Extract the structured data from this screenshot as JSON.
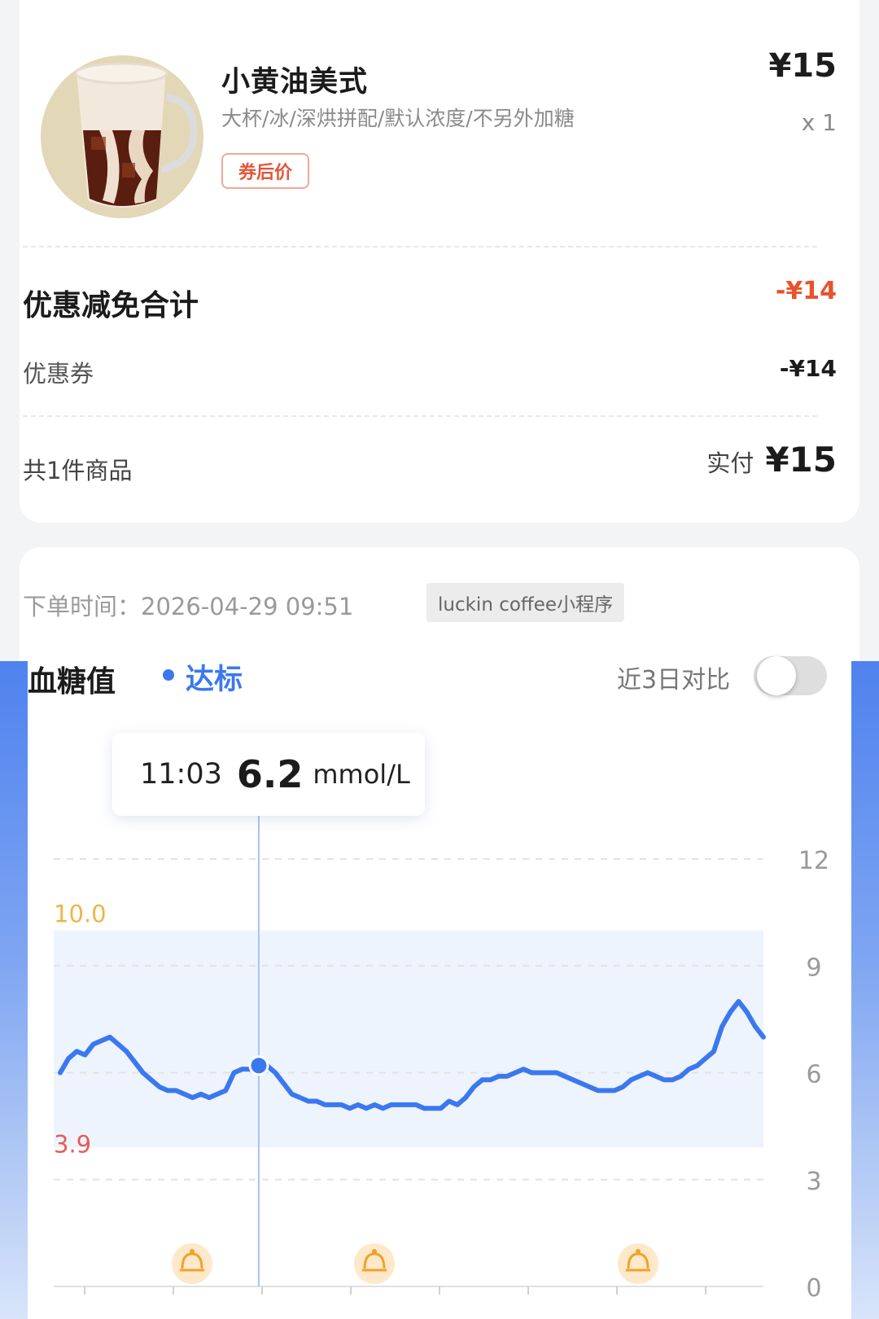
{
  "order": {
    "product_name": "小黄油美式",
    "product_spec": "大杯/冰/深烘拼配/默认浓度/不另外加糖",
    "badge": "券后价",
    "price": "¥15",
    "quantity": "x 1",
    "discount_title": "优惠减免合计",
    "discount_amount": "-¥14",
    "coupon_label": "优惠券",
    "coupon_amount": "-¥14",
    "items_count": "共1件商品",
    "paid_label": "实付",
    "paid_amount": "¥15"
  },
  "order_meta": {
    "order_time": "下单时间：2026-04-29 09:51",
    "source": "luckin coffee小程序"
  },
  "glucose": {
    "title": "血糖值",
    "status": "达标",
    "compare_label": "近3日对比",
    "compare_enabled": false,
    "tooltip": {
      "time": "11:03",
      "value": "6.2",
      "unit": "mmol/L"
    },
    "colors": {
      "accent": "#3b78f0",
      "upper_limit": "#f0b44a",
      "lower_limit": "#e85b5b",
      "target_band": "#eef4fd"
    }
  },
  "chart_data": {
    "type": "line",
    "y_ticks": [
      "12",
      "9",
      "6",
      "3",
      "0"
    ],
    "ylim": [
      0,
      12
    ],
    "target_range": {
      "low": 3.9,
      "high": 10.0,
      "low_label": "3.9",
      "high_label": "10.0"
    },
    "meal_markers": 3,
    "highlighted_point": {
      "time": "11:03",
      "value": 6.2
    },
    "series": [
      {
        "values": [
          6.0,
          6.4,
          6.6,
          6.5,
          6.8,
          6.9,
          7.0,
          6.8,
          6.6,
          6.3,
          6.0,
          5.8,
          5.6,
          5.5,
          5.5,
          5.4,
          5.3,
          5.4,
          5.3,
          5.4,
          5.5,
          6.0,
          6.1,
          6.1,
          6.2,
          6.2,
          6.0,
          5.7,
          5.4,
          5.3,
          5.2,
          5.2,
          5.1,
          5.1,
          5.1,
          5.0,
          5.1,
          5.0,
          5.1,
          5.0,
          5.1,
          5.1,
          5.1,
          5.1,
          5.0,
          5.0,
          5.0,
          5.2,
          5.1,
          5.3,
          5.6,
          5.8,
          5.8,
          5.9,
          5.9,
          6.0,
          6.1,
          6.0,
          6.0,
          6.0,
          6.0,
          5.9,
          5.8,
          5.7,
          5.6,
          5.5,
          5.5,
          5.5,
          5.6,
          5.8,
          5.9,
          6.0,
          5.9,
          5.8,
          5.8,
          5.9,
          6.1,
          6.2,
          6.4,
          6.6,
          7.3,
          7.7,
          8.0,
          7.7,
          7.3,
          7.0
        ]
      }
    ]
  }
}
